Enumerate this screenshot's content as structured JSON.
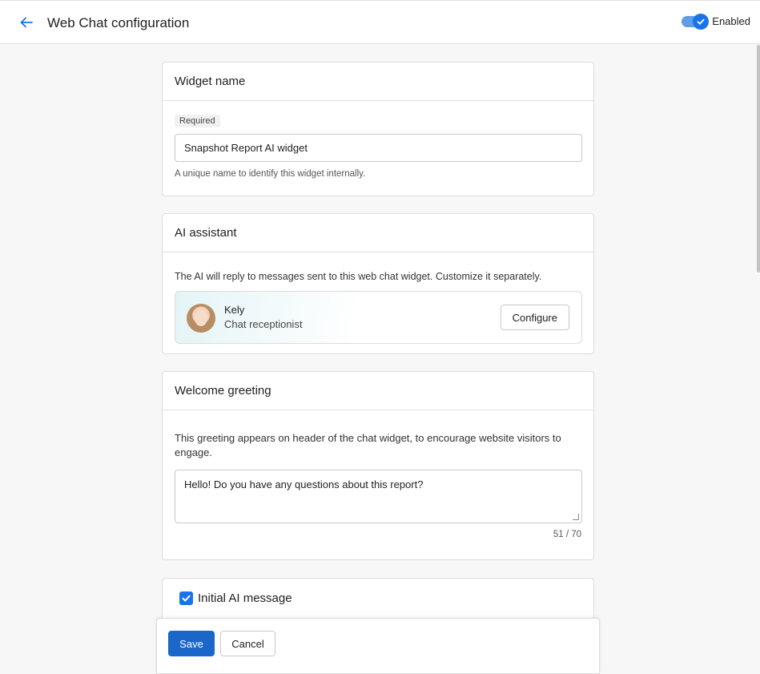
{
  "header": {
    "title": "Web Chat configuration",
    "toggle_label": "Enabled",
    "toggle_on": true
  },
  "widget_name": {
    "title": "Widget name",
    "chip": "Required",
    "value": "Snapshot Report AI widget",
    "helper": "A unique name to identify this widget internally."
  },
  "ai_assistant": {
    "title": "AI assistant",
    "description": "The AI will reply to messages sent to this web chat widget. Customize it separately.",
    "name": "Kely",
    "role": "Chat receptionist",
    "configure_label": "Configure"
  },
  "welcome_greeting": {
    "title": "Welcome greeting",
    "description": "This greeting appears on header of the chat widget, to encourage website visitors to engage.",
    "value": "Hello! Do you have any questions about this report?",
    "counter": "51 / 70"
  },
  "initial_message": {
    "label": "Initial AI message",
    "checked": true
  },
  "footer": {
    "save_label": "Save",
    "cancel_label": "Cancel"
  },
  "colors": {
    "accent": "#1a73e8",
    "primary_button": "#1a66c9"
  },
  "icons": {
    "back": "arrow-left-icon",
    "check": "check-icon"
  }
}
